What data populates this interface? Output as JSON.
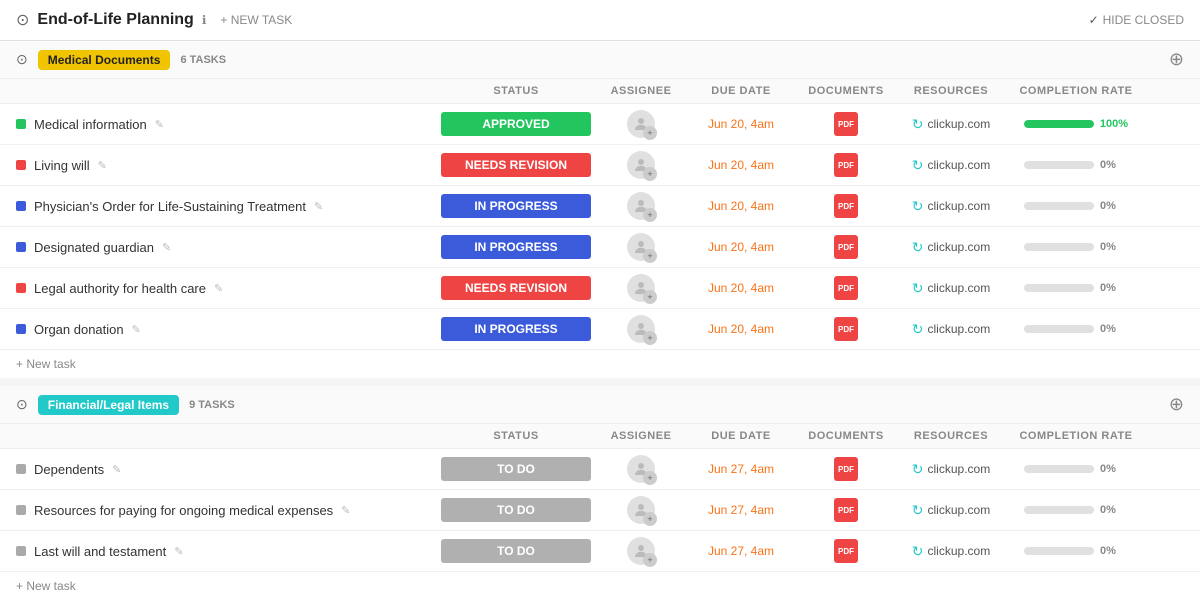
{
  "header": {
    "title": "End-of-Life Planning",
    "info_icon": "ℹ",
    "new_task_label": "+ NEW TASK",
    "hide_closed_label": "HIDE CLOSED",
    "check_mark": "✓"
  },
  "groups": [
    {
      "id": "medical",
      "tag_label": "Medical Documents",
      "tag_class": "group-tag-yellow",
      "task_count": "6 TASKS",
      "tasks": [
        {
          "name": "Medical information",
          "dot_class": "dot-green",
          "status": "APPROVED",
          "status_class": "status-approved",
          "due_date": "Jun 20, 4am",
          "progress": 100,
          "progress_label": "100%",
          "progress_color": "#22c55e"
        },
        {
          "name": "Living will",
          "dot_class": "dot-red",
          "status": "NEEDS REVISION",
          "status_class": "status-needs-revision",
          "due_date": "Jun 20, 4am",
          "progress": 0,
          "progress_label": "0%",
          "progress_color": "#e0e0e0"
        },
        {
          "name": "Physician's Order for Life-Sustaining Treatment",
          "dot_class": "dot-blue",
          "status": "IN PROGRESS",
          "status_class": "status-in-progress",
          "due_date": "Jun 20, 4am",
          "progress": 0,
          "progress_label": "0%",
          "progress_color": "#e0e0e0"
        },
        {
          "name": "Designated guardian",
          "dot_class": "dot-blue",
          "status": "IN PROGRESS",
          "status_class": "status-in-progress",
          "due_date": "Jun 20, 4am",
          "progress": 0,
          "progress_label": "0%",
          "progress_color": "#e0e0e0"
        },
        {
          "name": "Legal authority for health care",
          "dot_class": "dot-red",
          "status": "NEEDS REVISION",
          "status_class": "status-needs-revision",
          "due_date": "Jun 20, 4am",
          "progress": 0,
          "progress_label": "0%",
          "progress_color": "#e0e0e0"
        },
        {
          "name": "Organ donation",
          "dot_class": "dot-blue",
          "status": "IN PROGRESS",
          "status_class": "status-in-progress",
          "due_date": "Jun 20, 4am",
          "progress": 0,
          "progress_label": "0%",
          "progress_color": "#e0e0e0"
        }
      ],
      "new_task_label": "+ New task"
    },
    {
      "id": "financial",
      "tag_label": "Financial/Legal Items",
      "tag_class": "group-tag-cyan",
      "task_count": "9 TASKS",
      "tasks": [
        {
          "name": "Dependents",
          "dot_class": "dot-gray",
          "status": "TO DO",
          "status_class": "status-todo",
          "due_date": "Jun 27, 4am",
          "progress": 0,
          "progress_label": "0%",
          "progress_color": "#e0e0e0"
        },
        {
          "name": "Resources for paying for ongoing medical expenses",
          "dot_class": "dot-gray",
          "status": "TO DO",
          "status_class": "status-todo",
          "due_date": "Jun 27, 4am",
          "progress": 0,
          "progress_label": "0%",
          "progress_color": "#e0e0e0"
        },
        {
          "name": "Last will and testament",
          "dot_class": "dot-gray",
          "status": "TO DO",
          "status_class": "status-todo",
          "due_date": "Jun 27, 4am",
          "progress": 0,
          "progress_label": "0%",
          "progress_color": "#e0e0e0"
        }
      ],
      "new_task_label": "+ New task"
    }
  ],
  "columns": {
    "task": "",
    "status": "STATUS",
    "assignee": "ASSIGNEE",
    "due_date": "DUE DATE",
    "documents": "DOCUMENTS",
    "resources": "RESOURCES",
    "completion": "COMPLETION RATE"
  }
}
